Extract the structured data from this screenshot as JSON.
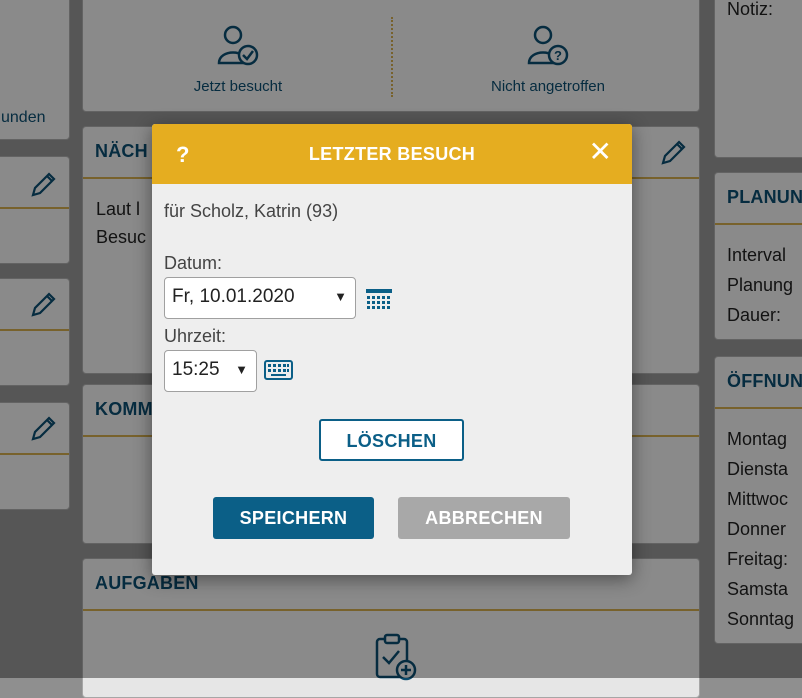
{
  "background": {
    "left_partial_text": "unden",
    "actions": {
      "visited_label": "Jetzt besucht",
      "not_found_label": "Nicht angetroffen"
    },
    "next_card": {
      "title_partial": "NÄCH",
      "line1": "Laut l",
      "line2": "Besuc"
    },
    "comment_card": {
      "title_partial": "KOMM"
    },
    "tasks_card": {
      "title": "AUFGABEN"
    },
    "notes": {
      "label": "Notiz:"
    },
    "planning": {
      "title_partial": "PLANUN",
      "rows": [
        "Interval",
        "Planung",
        "Dauer:"
      ]
    },
    "opening": {
      "title_partial": "ÖFFNUN",
      "days": [
        "Montag",
        "Diensta",
        "Mittwoc",
        "Donner",
        "Freitag:",
        "Samsta",
        "Sonntag"
      ]
    }
  },
  "modal": {
    "title": "LETZTER BESUCH",
    "help_symbol": "?",
    "close_symbol": "✕",
    "for_text": "für Scholz, Katrin (93)",
    "date_label": "Datum:",
    "date_value": "Fr, 10.01.2020",
    "time_label": "Uhrzeit:",
    "time_value": "15:25",
    "delete_label": "LÖSCHEN",
    "save_label": "SPEICHERN",
    "cancel_label": "ABBRECHEN"
  },
  "colors": {
    "accent": "#e5ad20",
    "primary": "#0b5f87",
    "muted": "#a8a8a8",
    "rule": "#c8a44a"
  }
}
